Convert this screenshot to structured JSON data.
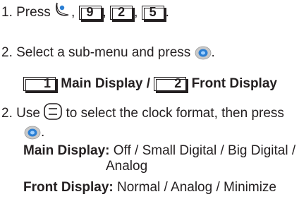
{
  "steps": {
    "s1_text": "1. Press",
    "s1_keys": [
      "9",
      "2",
      "5"
    ],
    "sep": ",",
    "end": ".",
    "s2_text": "2. Select a sub-menu and press",
    "submenu_key1": "1",
    "submenu_label1": "Main Display",
    "slash": "/",
    "submenu_key2": "2",
    "submenu_label2": "Front Display",
    "s3_text_a": "2. Use",
    "s3_text_b": "to select the clock format, then press",
    "main_label": "Main Display:",
    "main_options": "Off / Small Digital / Big Digital /",
    "main_options_cont": "Analog",
    "front_label": "Front Display:",
    "front_options": "Normal / Analog / Minimize"
  },
  "icons": {
    "menu_key": "menu-key-icon",
    "ok_key": "ok-key-icon",
    "nav_key": "navigation-key-icon"
  },
  "colors": {
    "text": "#231f20",
    "icon_blue": "#2b7fd4",
    "icon_gray": "#c9c9c9"
  }
}
